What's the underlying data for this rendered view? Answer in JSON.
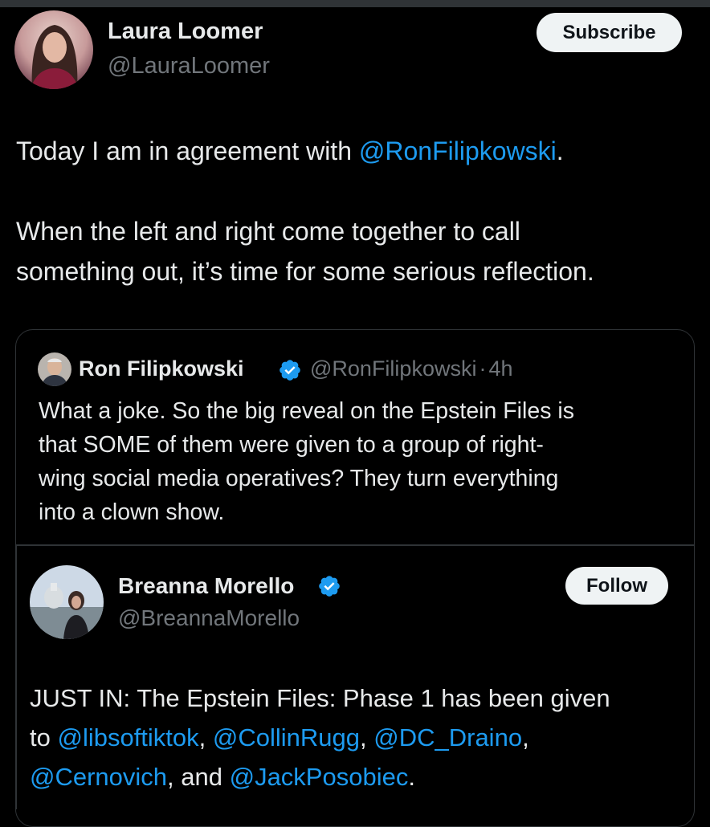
{
  "main_post": {
    "author_name": "Laura Loomer",
    "author_handle": "@LauraLoomer",
    "subscribe_label": "Subscribe",
    "line1_prefix": "Today I am in agreement with ",
    "line1_mention": "@RonFilipkowski",
    "line1_suffix": ".",
    "line2": "When the left and right come together to call",
    "line3": "something out, it’s time for some serious reflection."
  },
  "quoted_post": {
    "author_name": "Ron Filipkowski",
    "author_handle": "@RonFilipkowski",
    "separator": "·",
    "time": "4h",
    "verified_icon": "verified-badge-icon",
    "lines": [
      "What a joke. So the big reveal on the Epstein Files is",
      "that SOME of them were given to a group of right-",
      "wing social media operatives? They turn everything",
      "into a clown show."
    ]
  },
  "embedded_post": {
    "author_name": "Breanna Morello",
    "author_handle": "@BreannaMorello",
    "follow_label": "Follow",
    "verified_icon": "verified-badge-icon",
    "line1": "JUST IN: The Epstein Files: Phase 1 has been given",
    "line2_prefix": "to ",
    "mention_libsoftiktok": "@libsoftiktok",
    "comma1": ", ",
    "mention_collinrugg": "@CollinRugg",
    "comma2": ", ",
    "mention_dcdraino": "@DC_Draino",
    "comma3": ",",
    "mention_cernovich": "@Cernovich",
    "and_text": ", and ",
    "mention_jackposobiec": "@JackPosobiec",
    "period": "."
  },
  "colors": {
    "background": "#000000",
    "text": "#e7e9ea",
    "secondary_text": "#71767b",
    "link": "#1d9bf0",
    "border": "#2f3336",
    "button_bg": "#eff3f4"
  }
}
